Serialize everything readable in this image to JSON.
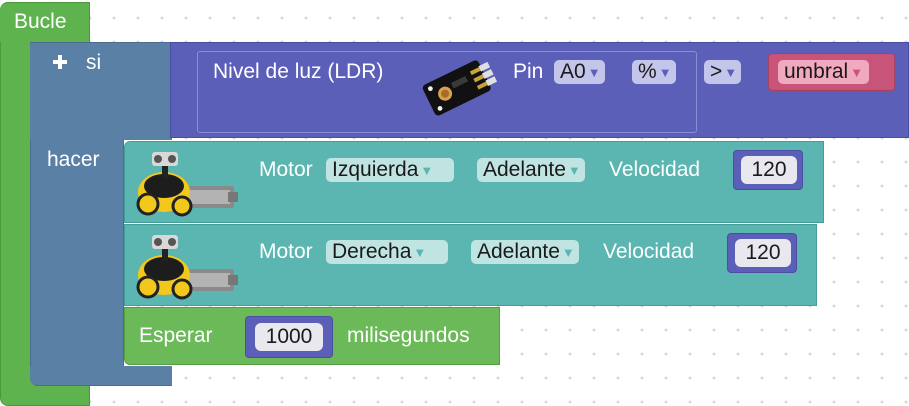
{
  "loop_block": {
    "label": "Bucle"
  },
  "if_block": {
    "add_icon": "plus-icon",
    "if_label": "si",
    "do_label": "hacer"
  },
  "light_sensor_block": {
    "label": "Nivel de luz (LDR)",
    "sensor_image": "ldr-sensor-module",
    "pin_label": "Pin",
    "pin_value": "A0",
    "unit_value": "%"
  },
  "comparison": {
    "operator": ">"
  },
  "threshold_variable": {
    "name": "umbral"
  },
  "motor_blocks": [
    {
      "label": "Motor",
      "side": "Izquierda",
      "direction": "Adelante",
      "speed_label": "Velocidad",
      "speed": "120",
      "robot_image": "robot-car"
    },
    {
      "label": "Motor",
      "side": "Derecha",
      "direction": "Adelante",
      "speed_label": "Velocidad",
      "speed": "120",
      "robot_image": "robot-car"
    }
  ],
  "wait_block": {
    "label": "Esperar",
    "value": "1000",
    "unit_label": "milisegundos"
  },
  "dropdown_arrow": "▼",
  "colors": {
    "loop_green": "#5fb34f",
    "if_blue": "#5b80a5",
    "sensor_purple": "#5b5fb8",
    "motor_teal": "#5bb5b0",
    "variable_pink": "#c8547a",
    "wait_green": "#6cb95a"
  }
}
